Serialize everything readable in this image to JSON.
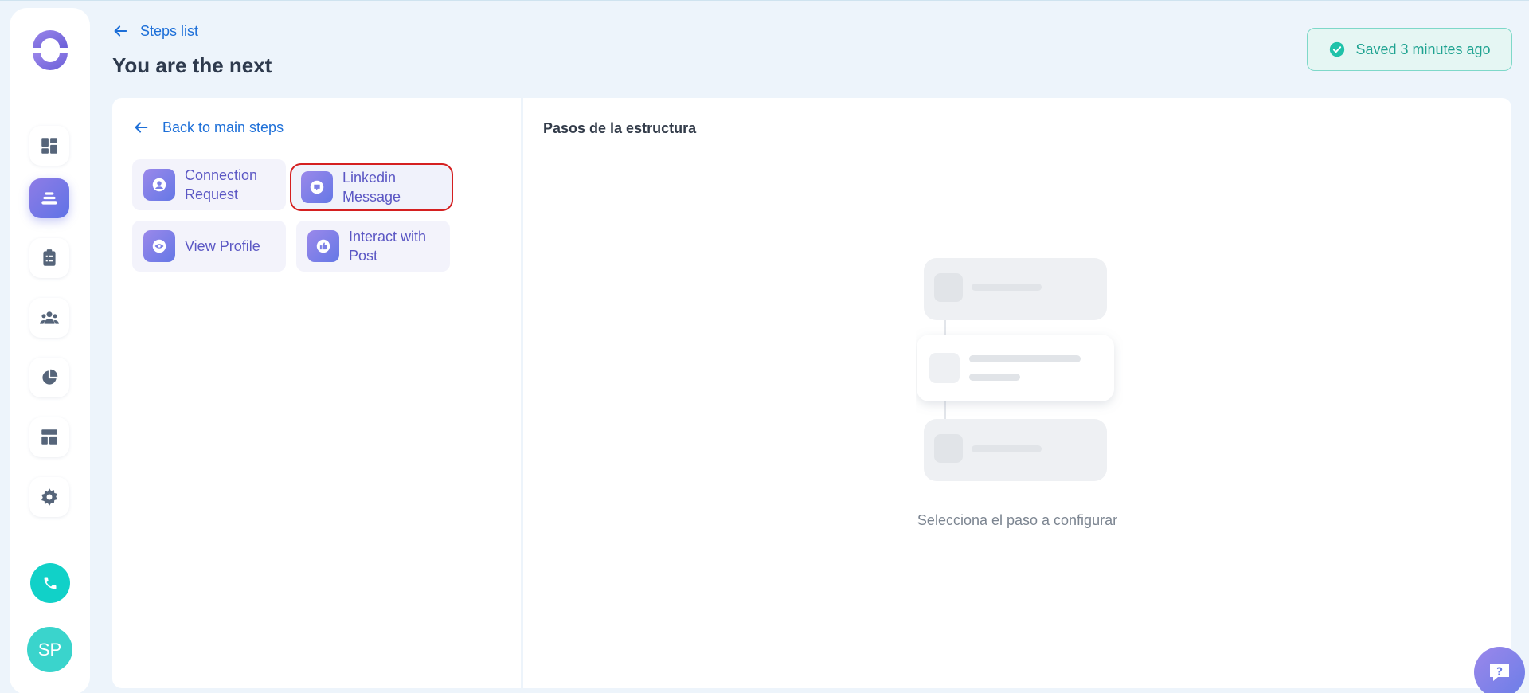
{
  "header": {
    "back_label": "Steps list",
    "title": "You are the next",
    "saved_status": "Saved 3 minutes ago"
  },
  "sidebar": {
    "items": [
      {
        "name": "dashboard",
        "icon": "dashboard-icon"
      },
      {
        "name": "sequences",
        "icon": "stack-icon",
        "active": true
      },
      {
        "name": "tasks",
        "icon": "clipboard-icon"
      },
      {
        "name": "contacts",
        "icon": "users-icon"
      },
      {
        "name": "reports",
        "icon": "pie-chart-icon"
      },
      {
        "name": "templates",
        "icon": "layout-icon"
      },
      {
        "name": "settings",
        "icon": "gear-icon"
      }
    ],
    "phone_icon": "phone-icon",
    "avatar_initials": "SP"
  },
  "left_panel": {
    "back_label": "Back to main steps",
    "steps": [
      {
        "label": "Connection Request",
        "icon": "user-icon"
      },
      {
        "label": "Linkedin Message",
        "icon": "chat-icon",
        "highlighted": true
      },
      {
        "label": "View Profile",
        "icon": "eye-icon"
      },
      {
        "label": "Interact with Post",
        "icon": "thumbs-up-icon"
      }
    ]
  },
  "right_panel": {
    "title": "Pasos de la estructura",
    "empty_message": "Selecciona el paso a configurar"
  },
  "colors": {
    "accent": "#5f73e6",
    "link": "#1d6fd8",
    "success": "#1fa391",
    "highlight_border": "#d52020"
  }
}
